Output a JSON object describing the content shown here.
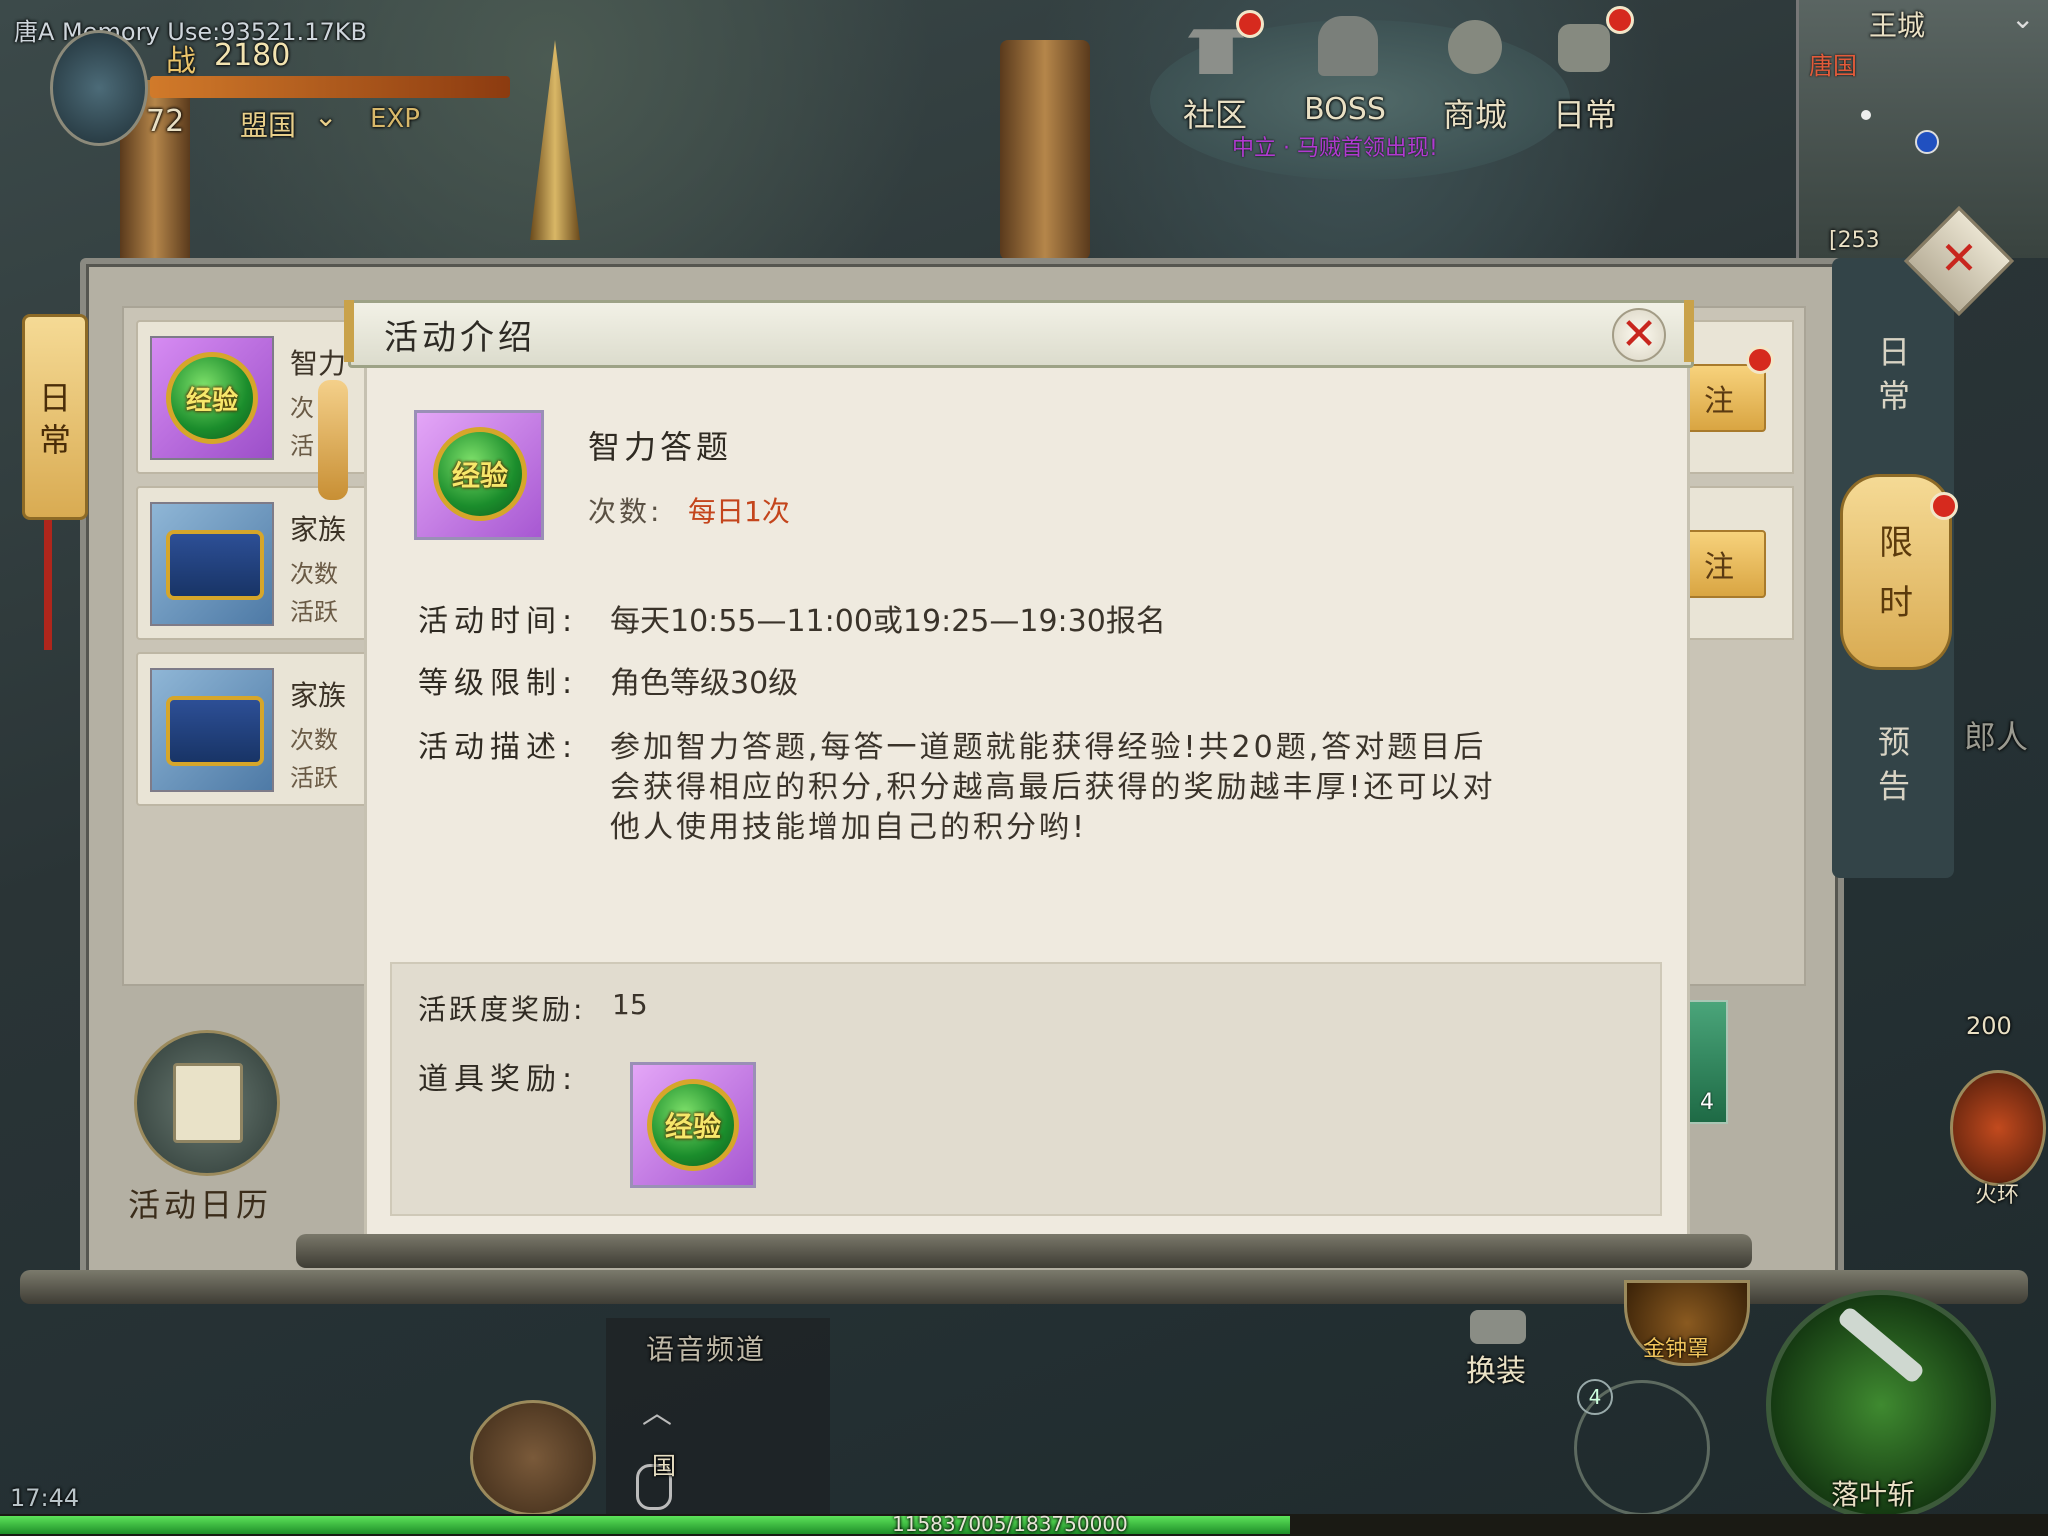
{
  "hud": {
    "memory_debug": "唐A Memory Use:93521.17KB",
    "power_label": "战",
    "power_value": "2180",
    "level": "72",
    "nation_label": "盟国",
    "exp_label": "EXP",
    "clock": "17:44",
    "exp_progress_text": "115837005/183750000",
    "exp_progress_fraction": 0.63
  },
  "top_menu": [
    {
      "label": "社区",
      "icon": "pavilion-icon"
    },
    {
      "label": "BOSS",
      "icon": "boss-helmet-icon"
    },
    {
      "label": "商城",
      "icon": "shop-icon"
    },
    {
      "label": "日常",
      "icon": "daily-icon"
    }
  ],
  "announcement": "中立 · 马贼首领出现!",
  "minimap": {
    "region": "王城",
    "nation": "唐国",
    "coords": "[253"
  },
  "left_panel": {
    "tab_daily": "日常"
  },
  "activity_list": [
    {
      "title": "智力",
      "line1": "次",
      "line2": "活",
      "icon": "经验",
      "action": "注"
    },
    {
      "title": "家族",
      "line1": "次数",
      "line2": "活跃",
      "icon": "chest",
      "action": "注"
    },
    {
      "title": "家族",
      "line1": "次数",
      "line2": "活跃",
      "icon": "chest",
      "action": ""
    }
  ],
  "right_tabs": {
    "daily": "日常",
    "limited": "限时",
    "preview": "预告"
  },
  "bottom": {
    "calendar_label": "活动日历",
    "voice_channel": "语音频道",
    "nation_chat": "国",
    "equip_swap": "换装",
    "skill_golden_bell": "金钟罩",
    "skill_main": "落叶斩",
    "side_value": "200",
    "side_skill": "火环",
    "counter": "4",
    "side_people": "郎人",
    "stack_count": "4"
  },
  "dialog": {
    "title": "活动介绍",
    "activity_name": "智力答题",
    "icon_text": "经验",
    "times_label": "次数:",
    "times_value": "每日1次",
    "time_label": "活动时间:",
    "time_value": "每天10:55—11:00或19:25—19:30报名",
    "level_label": "等级限制:",
    "level_value": "角色等级30级",
    "desc_label": "活动描述:",
    "desc_lines": [
      "参加智力答题,每答一道题就能获得经验!共20题,答对题目后",
      "会获得相应的积分,积分越高最后获得的奖励越丰厚!还可以对",
      "他人使用技能增加自己的积分哟!"
    ],
    "activity_reward_label": "活跃度奖励:",
    "activity_reward_value": "15",
    "item_reward_label": "道具奖励:",
    "item_reward_icon_text": "经验"
  },
  "colors": {
    "accent_orange": "#c4451c",
    "close_red": "#c8261e",
    "dialog_bg": "#efeadf"
  }
}
